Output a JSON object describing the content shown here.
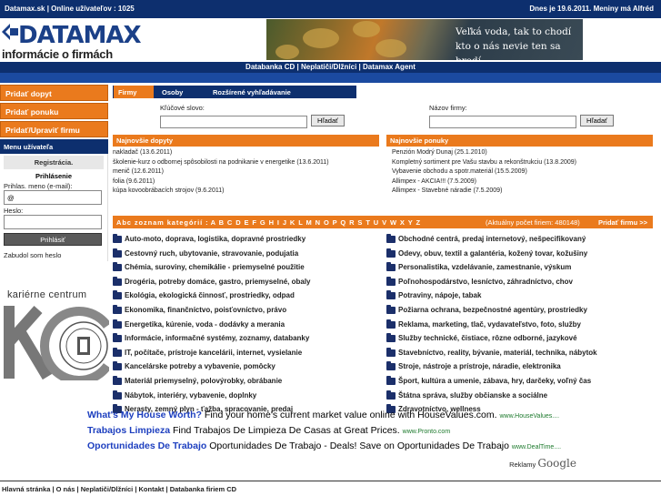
{
  "topbar": {
    "left": "Datamax.sk | Online užívateľov : 1025",
    "right": "Dnes je 19.6.2011. Meniny má Alfréd"
  },
  "logo": {
    "brand_a": "DATA",
    "brand_b": "MAX",
    "subtitle": "informácie o firmách"
  },
  "banner": {
    "line1": "Veľká voda, tak to chodí",
    "line2": "kto o nás nevie ten sa brodí."
  },
  "nav": "Databanka CD | Neplatiči/Dlžníci | Datamax Agent",
  "left_buttons": [
    "Pridať dopyt",
    "Pridať ponuku",
    "Pridať/Upraviť firmu"
  ],
  "user_menu": {
    "title": "Menu užívateľa",
    "registration": "Registrácia.",
    "login_title": "Prihlásenie",
    "name_label": "Prihlas. meno (e-mail):",
    "name_value": "@",
    "pass_label": "Heslo:",
    "submit": "Prihlásiť",
    "forgot": "Zabudol som heslo"
  },
  "kc": {
    "title": "kariérne centrum"
  },
  "tabs": [
    "Firmy",
    "Osoby",
    "Rozšírené vyhľadávanie"
  ],
  "search": {
    "keyword_label": "Kľúčové slovo:",
    "company_label": "Názov firmy:",
    "button": "Hľadať"
  },
  "demands": {
    "title": "Najnovšie dopyty",
    "items": [
      "nakladač (13.6.2011)",
      "školenie-kurz o odbornej spôsobilosti na podnikanie v energetike (13.6.2011)",
      "menič (12.6.2011)",
      "folia (9.6.2011)",
      "kúpa kovoobrábacích strojov (9.6.2011)"
    ]
  },
  "offers": {
    "title": "Najnovšie ponuky",
    "items": [
      "Penzión Modrý Dunaj (25.1.2010)",
      "Kompletný sortiment pre Vašu stavbu a rekonštrukciu (13.8.2009)",
      "Vybavenie obchodu a spotr.materiál (15.5.2009)",
      "Allimpex - AKCIA!!! (7.5.2009)",
      "Allimpex - Stavebné náradie (7.5.2009)"
    ]
  },
  "abc": {
    "label": "Abc zoznam kategórií :",
    "letters": "A B C D E F G H I J K L M N O P Q R S T U V W X Y Z",
    "count": "(Aktuálny počet firiem: 480148)",
    "add": "Pridať firmu >>"
  },
  "categories_left": [
    "Auto-moto, doprava, logistika, dopravné prostriedky",
    "Cestovný ruch, ubytovanie, stravovanie, podujatia",
    "Chémia, suroviny, chemikálie - priemyselné použitie",
    "Drogéria, potreby domáce, gastro, priemyselné, obaly",
    "Ekológia, ekologická činnosť, prostriedky, odpad",
    "Ekonomika, finančníctvo, poisťovníctvo, právo",
    "Energetika, kúrenie, voda - dodávky a merania",
    "Informácie, informačné systémy, zoznamy, databanky",
    "IT, počítače, prístroje kancelárii, internet, vysielanie",
    "Kancelárske potreby a vybavenie, pomôcky",
    "Materiál priemyselný, polovýrobky, obrábanie",
    "Nábytok, interiéry, vybavenie, doplnky",
    "Nerasty, zemný plyn - ťažba, spracovanie, predaj"
  ],
  "categories_right": [
    "Obchodné centrá, predaj internetový, nešpecifikovaný",
    "Odevy, obuv, textil a galantéria, kožený tovar, kožušiny",
    "Personalistika, vzdelávanie, zamestnanie, výskum",
    "Poľnohospodárstvo, lesníctvo, záhradníctvo, chov",
    "Potraviny, nápoje, tabak",
    "Požiarna ochrana, bezpečnostné agentúry, prostriedky",
    "Reklama, marketing, tlač, vydavateľstvo, foto, služby",
    "Služby technické, čistiace, rôzne odborné, jazykové",
    "Stavebníctvo, reality, bývanie, materiál, technika, nábytok",
    "Stroje, nástroje a prístroje, náradie, elektronika",
    "Šport, kultúra a umenie, zábava, hry, darčeky, voľný čas",
    "Štátna správa, služby občianske a sociálne",
    "Zdravotníctvo, wellness"
  ],
  "ads": [
    {
      "h": "What's My House Worth?",
      "t": " Find your home's current market value online with HouseValues.com. ",
      "u": "www.HouseValues...."
    },
    {
      "h": "Trabajos Limpieza",
      "t": " Find Trabajos De Limpieza De Casas at Great Prices. ",
      "u": "www.Pronto.com"
    },
    {
      "h": "Oportunidades De Trabajo",
      "t": " Oportunidades De Trabajo - Deals! Save on Oportunidades De Trabajo ",
      "u": "www.DealTime...."
    }
  ],
  "ads_label": "Reklamy",
  "ads_brand": "Google",
  "footer": "Hlavná stránka | O nás | Neplatiči/Dlžníci | Kontakt |  Databanka firiem CD"
}
